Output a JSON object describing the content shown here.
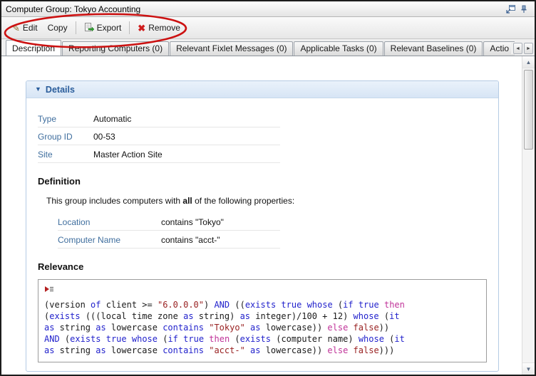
{
  "window": {
    "title": "Computer Group: Tokyo Accounting"
  },
  "toolbar": {
    "edit_label": "Edit",
    "copy_label": "Copy",
    "export_label": "Export",
    "remove_label": "Remove"
  },
  "tabs": [
    {
      "label": "Description",
      "active": true
    },
    {
      "label": "Reporting Computers (0)",
      "active": false
    },
    {
      "label": "Relevant Fixlet Messages (0)",
      "active": false
    },
    {
      "label": "Applicable Tasks (0)",
      "active": false
    },
    {
      "label": "Relevant Baselines (0)",
      "active": false
    },
    {
      "label": "Actio",
      "active": false
    }
  ],
  "icons": {
    "details_collapse": "▼",
    "scroll_up": "▲",
    "scroll_down": "▼",
    "tab_scroll_left": "◄",
    "tab_scroll_right": "►",
    "edit_pencil": "✎",
    "remove_x": "✖"
  },
  "details": {
    "header_label": "Details",
    "fields": [
      {
        "label": "Type",
        "value": "Automatic"
      },
      {
        "label": "Group ID",
        "value": "00-53"
      },
      {
        "label": "Site",
        "value": "Master Action Site"
      }
    ],
    "definition": {
      "heading": "Definition",
      "intro_prefix": "This group includes computers with ",
      "intro_bold": "all",
      "intro_suffix": " of the following properties:",
      "properties": [
        {
          "label": "Location",
          "value": "contains \"Tokyo\""
        },
        {
          "label": "Computer Name",
          "value": "contains \"acct-\""
        }
      ]
    },
    "relevance": {
      "heading": "Relevance",
      "code_lines": [
        [
          [
            "(version ",
            "p"
          ],
          [
            "of",
            "k"
          ],
          [
            " client >= ",
            "p"
          ],
          [
            "\"6.0.0.0\"",
            "s"
          ],
          [
            ") ",
            "p"
          ],
          [
            "AND",
            "k"
          ],
          [
            " ((",
            "p"
          ],
          [
            "exists",
            "k"
          ],
          [
            " ",
            "p"
          ],
          [
            "true",
            "k"
          ],
          [
            " ",
            "p"
          ],
          [
            "whose",
            "k"
          ],
          [
            " (",
            "p"
          ],
          [
            "if",
            "k"
          ],
          [
            " ",
            "p"
          ],
          [
            "true",
            "k"
          ],
          [
            " ",
            "p"
          ],
          [
            "then",
            "m"
          ]
        ],
        [
          [
            "(",
            "p"
          ],
          [
            "exists",
            "k"
          ],
          [
            " (((local time zone ",
            "p"
          ],
          [
            "as",
            "k"
          ],
          [
            " string) ",
            "p"
          ],
          [
            "as",
            "k"
          ],
          [
            " integer)/100 + 12) ",
            "p"
          ],
          [
            "whose",
            "k"
          ],
          [
            " (",
            "p"
          ],
          [
            "it",
            "k"
          ]
        ],
        [
          [
            "as",
            "k"
          ],
          [
            " string ",
            "p"
          ],
          [
            "as",
            "k"
          ],
          [
            " lowercase ",
            "p"
          ],
          [
            "contains",
            "k"
          ],
          [
            " ",
            "p"
          ],
          [
            "\"Tokyo\"",
            "s"
          ],
          [
            " ",
            "p"
          ],
          [
            "as",
            "k"
          ],
          [
            " lowercase)) ",
            "p"
          ],
          [
            "else",
            "m"
          ],
          [
            " ",
            "p"
          ],
          [
            "false",
            "s"
          ],
          [
            "))",
            "p"
          ]
        ],
        [
          [
            "AND",
            "k"
          ],
          [
            " (",
            "p"
          ],
          [
            "exists",
            "k"
          ],
          [
            " ",
            "p"
          ],
          [
            "true",
            "k"
          ],
          [
            " ",
            "p"
          ],
          [
            "whose",
            "k"
          ],
          [
            " (",
            "p"
          ],
          [
            "if",
            "k"
          ],
          [
            " ",
            "p"
          ],
          [
            "true",
            "k"
          ],
          [
            " ",
            "p"
          ],
          [
            "then",
            "m"
          ],
          [
            " (",
            "p"
          ],
          [
            "exists",
            "k"
          ],
          [
            " (computer name) ",
            "p"
          ],
          [
            "whose",
            "k"
          ],
          [
            " (",
            "p"
          ],
          [
            "it",
            "k"
          ]
        ],
        [
          [
            "as",
            "k"
          ],
          [
            " string ",
            "p"
          ],
          [
            "as",
            "k"
          ],
          [
            " lowercase ",
            "p"
          ],
          [
            "contains",
            "k"
          ],
          [
            " ",
            "p"
          ],
          [
            "\"acct-\"",
            "s"
          ],
          [
            " ",
            "p"
          ],
          [
            "as",
            "k"
          ],
          [
            " lowercase)) ",
            "p"
          ],
          [
            "else",
            "m"
          ],
          [
            " ",
            "p"
          ],
          [
            "false",
            "s"
          ],
          [
            ")))",
            "p"
          ]
        ]
      ]
    }
  },
  "colors": {
    "annotation_red": "#cc1111",
    "keyword_blue": "#2222cc",
    "string_red": "#992222",
    "flow_magenta": "#c03399",
    "label_blue": "#3f6e9e",
    "header_blue": "#2a5d9b"
  }
}
